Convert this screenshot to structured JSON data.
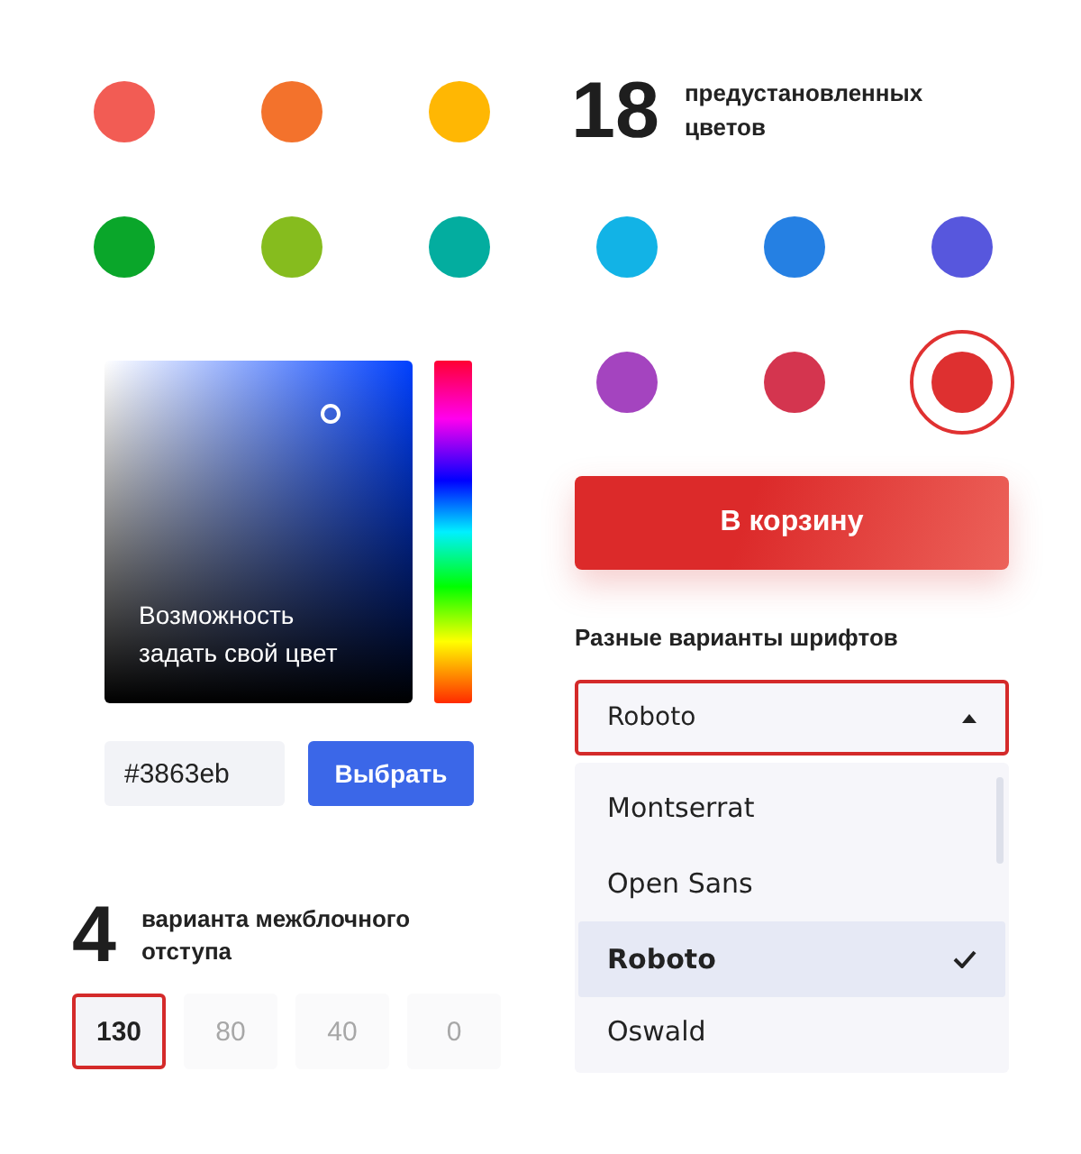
{
  "swatches": [
    {
      "color": "#f25c54",
      "selected": false
    },
    {
      "color": "#f3722c",
      "selected": false
    },
    {
      "color": "#ffb703",
      "selected": false
    },
    {
      "color": "#0aa62a",
      "selected": false
    },
    {
      "color": "#86bc1e",
      "selected": false
    },
    {
      "color": "#03ad9f",
      "selected": false
    },
    {
      "color": "#12b3e6",
      "selected": false
    },
    {
      "color": "#2580e3",
      "selected": false
    },
    {
      "color": "#5757dd",
      "selected": false
    },
    {
      "color": "#a444bf",
      "selected": false
    },
    {
      "color": "#d4354f",
      "selected": false
    },
    {
      "color": "#de3030",
      "selected": true
    }
  ],
  "presets_heading": {
    "number": "18",
    "caption": "предустановленных цветов"
  },
  "picker": {
    "caption": "Возможность задать свой цвет",
    "hex_value": "#3863eb",
    "apply_button": "Выбрать"
  },
  "spacing": {
    "number": "4",
    "caption": "варианта межблочного отступа",
    "options": [
      {
        "label": "130",
        "selected": true
      },
      {
        "label": "80",
        "selected": false
      },
      {
        "label": "40",
        "selected": false
      },
      {
        "label": "0",
        "selected": false
      }
    ]
  },
  "cart_button": "В корзину",
  "fonts": {
    "label": "Разные варианты шрифтов",
    "value": "Roboto",
    "expanded": true,
    "options": [
      {
        "label": "Montserrat",
        "selected": false
      },
      {
        "label": "Open Sans",
        "selected": false
      },
      {
        "label": "Roboto",
        "selected": true
      },
      {
        "label": "Oswald",
        "selected": false
      }
    ]
  }
}
